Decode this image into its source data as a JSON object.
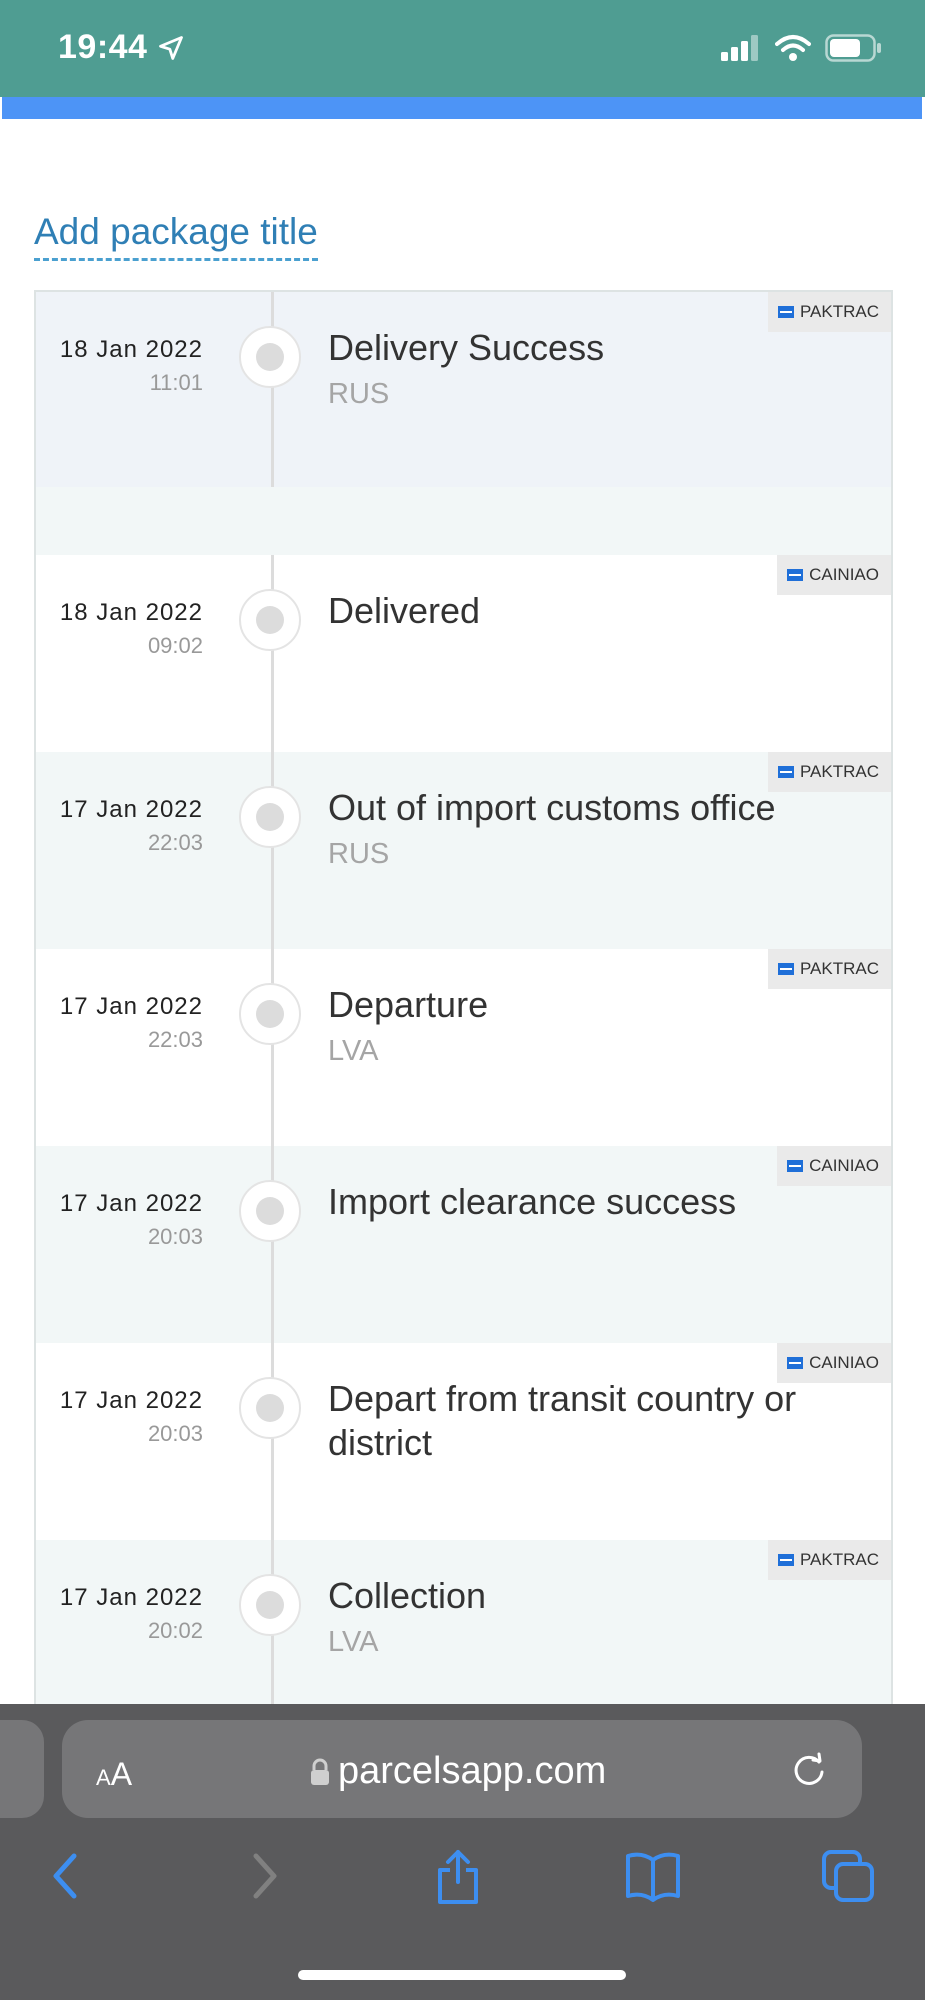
{
  "status": {
    "time": "19:44"
  },
  "page": {
    "title_link": "Add package title"
  },
  "events": [
    {
      "date": "18 Jan 2022",
      "time": "11:01",
      "title": "Delivery Success",
      "location": "RUS",
      "carrier": "PAKTRAC"
    },
    {
      "date": "18 Jan 2022",
      "time": "09:02",
      "title": "Delivered",
      "location": "",
      "carrier": "CAINIAO"
    },
    {
      "date": "17 Jan 2022",
      "time": "22:03",
      "title": "Out of import customs office",
      "location": "RUS",
      "carrier": "PAKTRAC"
    },
    {
      "date": "17 Jan 2022",
      "time": "22:03",
      "title": "Departure",
      "location": "LVA",
      "carrier": "PAKTRAC"
    },
    {
      "date": "17 Jan 2022",
      "time": "20:03",
      "title": "Import clearance success",
      "location": "",
      "carrier": "CAINIAO"
    },
    {
      "date": "17 Jan 2022",
      "time": "20:03",
      "title": "Depart from transit country or district",
      "location": "",
      "carrier": "CAINIAO"
    },
    {
      "date": "17 Jan 2022",
      "time": "20:02",
      "title": "Collection",
      "location": "LVA",
      "carrier": "PAKTRAC"
    }
  ],
  "browser": {
    "aa_label_big": "A",
    "aa_label_small": "A",
    "url": "parcelsapp.com"
  },
  "icons": [
    "location-arrow-icon",
    "signal-icon",
    "wifi-icon",
    "battery-icon",
    "lock-icon",
    "reload-icon",
    "back-icon",
    "forward-icon",
    "share-icon",
    "bookmarks-icon",
    "tabs-icon"
  ]
}
